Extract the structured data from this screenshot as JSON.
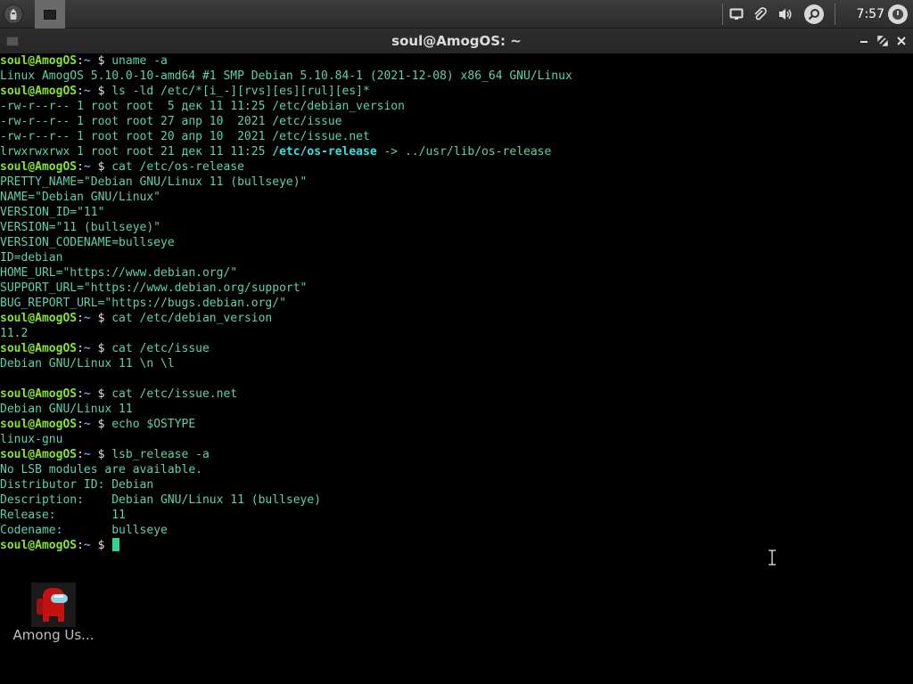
{
  "panel": {
    "clock": "7:57",
    "icons": [
      "menu-icon",
      "terminal-icon",
      "display-icon",
      "clip-icon",
      "volume-icon",
      "search-icon",
      "power-icon"
    ]
  },
  "window": {
    "title": "soul@AmogOS: ~"
  },
  "prompt": {
    "user": "soul@AmogOS",
    "sep": ":",
    "path": "~",
    "sym": " $ "
  },
  "terminal_lines": [
    {
      "type": "prompt",
      "cmd": "uname -a"
    },
    {
      "type": "out",
      "text": "Linux AmogOS 5.10.0-10-amd64 #1 SMP Debian 5.10.84-1 (2021-12-08) x86_64 GNU/Linux"
    },
    {
      "type": "prompt",
      "cmd": "ls -ld /etc/*[i_-][rvs][es][rul][es]*"
    },
    {
      "type": "out",
      "text": "-rw-r--r-- 1 root root  5 дек 11 11:25 /etc/debian_version"
    },
    {
      "type": "out",
      "text": "-rw-r--r-- 1 root root 27 апр 10  2021 /etc/issue"
    },
    {
      "type": "out",
      "text": "-rw-r--r-- 1 root root 20 апр 10  2021 /etc/issue.net"
    },
    {
      "type": "link",
      "pre": "lrwxrwxrwx 1 root root 21 дек 11 11:25 ",
      "link": "/etc/os-release",
      "post": " -> ../usr/lib/os-release"
    },
    {
      "type": "prompt",
      "cmd": "cat /etc/os-release"
    },
    {
      "type": "out",
      "text": "PRETTY_NAME=\"Debian GNU/Linux 11 (bullseye)\""
    },
    {
      "type": "out",
      "text": "NAME=\"Debian GNU/Linux\""
    },
    {
      "type": "out",
      "text": "VERSION_ID=\"11\""
    },
    {
      "type": "out",
      "text": "VERSION=\"11 (bullseye)\""
    },
    {
      "type": "out",
      "text": "VERSION_CODENAME=bullseye"
    },
    {
      "type": "out",
      "text": "ID=debian"
    },
    {
      "type": "out",
      "text": "HOME_URL=\"https://www.debian.org/\""
    },
    {
      "type": "out",
      "text": "SUPPORT_URL=\"https://www.debian.org/support\""
    },
    {
      "type": "out",
      "text": "BUG_REPORT_URL=\"https://bugs.debian.org/\""
    },
    {
      "type": "prompt",
      "cmd": "cat /etc/debian_version"
    },
    {
      "type": "out",
      "text": "11.2"
    },
    {
      "type": "prompt",
      "cmd": "cat /etc/issue"
    },
    {
      "type": "out",
      "text": "Debian GNU/Linux 11 \\n \\l"
    },
    {
      "type": "out",
      "text": ""
    },
    {
      "type": "prompt",
      "cmd": "cat /etc/issue.net"
    },
    {
      "type": "out",
      "text": "Debian GNU/Linux 11"
    },
    {
      "type": "prompt",
      "cmd": "echo $OSTYPE"
    },
    {
      "type": "out",
      "text": "linux-gnu"
    },
    {
      "type": "prompt",
      "cmd": "lsb_release -a"
    },
    {
      "type": "out",
      "text": "No LSB modules are available."
    },
    {
      "type": "out",
      "text": "Distributor ID:\tDebian"
    },
    {
      "type": "out",
      "text": "Description:\tDebian GNU/Linux 11 (bullseye)"
    },
    {
      "type": "out",
      "text": "Release:\t11"
    },
    {
      "type": "out",
      "text": "Codename:\tbullseye"
    },
    {
      "type": "prompt",
      "cmd": "",
      "cursor": true
    }
  ],
  "desktop": {
    "among_us_label": "Among Us..."
  },
  "colors": {
    "prompt_user": "#8ae234",
    "prompt_path": "#729fcf",
    "output": "#5fd0b0",
    "link": "#34e2e2",
    "cursor": "#2fd38a"
  }
}
